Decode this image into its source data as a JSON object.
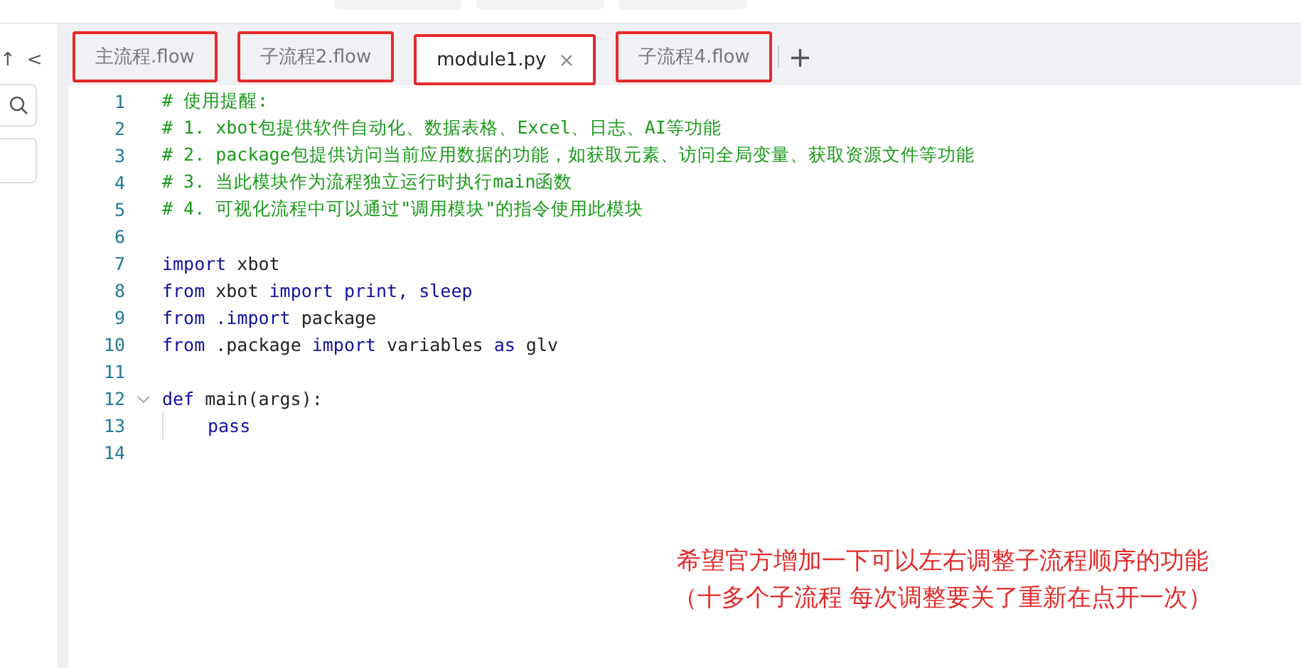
{
  "toolbar_buttons": [
    {
      "kind": "blank"
    },
    {
      "kind": "blank"
    },
    {
      "kind": "blank"
    }
  ],
  "sidebar": {
    "icons": [
      "↑",
      "<"
    ]
  },
  "tabs": [
    {
      "label": "主流程.flow",
      "selected": false,
      "closable": false,
      "boxed": true
    },
    {
      "label": "子流程2.flow",
      "selected": false,
      "closable": false,
      "boxed": true
    },
    {
      "label": "module1.py",
      "selected": true,
      "closable": true,
      "boxed": true
    },
    {
      "label": "子流程4.flow",
      "selected": false,
      "closable": false,
      "boxed": true
    }
  ],
  "add_tab": "+",
  "code_lines": [
    {
      "number": "1",
      "segments": [
        {
          "kind": "comment",
          "text": "# 使用提醒:"
        }
      ]
    },
    {
      "number": "2",
      "segments": [
        {
          "kind": "comment",
          "text": "# 1. xbot包提供软件自动化、数据表格、Excel、日志、AI等功能"
        }
      ]
    },
    {
      "number": "3",
      "segments": [
        {
          "kind": "comment",
          "text": "# 2. package包提供访问当前应用数据的功能，如获取元素、访问全局变量、获取资源文件等功能"
        }
      ]
    },
    {
      "number": "4",
      "segments": [
        {
          "kind": "comment",
          "text": "# 3. 当此模块作为流程独立运行时执行main函数"
        }
      ]
    },
    {
      "number": "5",
      "segments": [
        {
          "kind": "comment",
          "text": "# 4. 可视化流程中可以通过\"调用模块\"的指令使用此模块"
        }
      ]
    },
    {
      "number": "6"
    },
    {
      "number": "7",
      "segments": [
        {
          "kind": "keyword",
          "text": "import"
        },
        {
          "kind": "plain",
          "text": " xbot"
        }
      ]
    },
    {
      "number": "8",
      "segments": [
        {
          "kind": "keyword",
          "text": "from"
        },
        {
          "kind": "plain",
          "text": " xbot "
        },
        {
          "kind": "keyword",
          "text": "import print, sleep"
        }
      ]
    },
    {
      "number": "9",
      "segments": [
        {
          "kind": "keyword",
          "text": "from "
        },
        {
          "kind": "keyword",
          "text": ".import"
        },
        {
          "kind": "plain",
          "text": " package"
        }
      ]
    },
    {
      "number": "10",
      "segments": [
        {
          "kind": "keyword",
          "text": "from"
        },
        {
          "kind": "plain",
          "text": " .package "
        },
        {
          "kind": "keyword",
          "text": "import"
        },
        {
          "kind": "plain",
          "text": " variables "
        },
        {
          "kind": "keyword",
          "text": "as"
        },
        {
          "kind": "plain",
          "text": " glv"
        }
      ]
    },
    {
      "number": "11"
    },
    {
      "number": "12",
      "foldable": true,
      "segments": [
        {
          "kind": "keyword",
          "text": "def"
        },
        {
          "kind": "plain",
          "text": " main(args):"
        }
      ]
    },
    {
      "number": "13",
      "indent": true,
      "segments": [
        {
          "kind": "keyword",
          "text": "pass"
        }
      ]
    },
    {
      "number": "14"
    }
  ],
  "note": [
    "希望官方增加一下可以左右调整子流程顺序的功能",
    "（十多个子流程 每次调整要关了重新在点开一次）"
  ]
}
